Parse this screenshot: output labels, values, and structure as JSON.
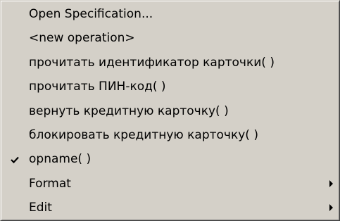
{
  "menu": {
    "items": [
      {
        "label": "Open Specification..."
      },
      {
        "label": "<new operation>"
      },
      {
        "label": "прочитать идентификатор карточки( )"
      },
      {
        "label": "прочитать ПИН-код( )"
      },
      {
        "label": "вернуть кредитную карточку( )"
      },
      {
        "label": "блокировать кредитную карточку( )"
      },
      {
        "label": "opname( )",
        "checked": true,
        "icon": "check-icon"
      },
      {
        "label": "Format",
        "submenu": true,
        "icon": "submenu-arrow-icon"
      },
      {
        "label": "Edit",
        "submenu": true,
        "icon": "submenu-arrow-icon"
      }
    ]
  },
  "colors": {
    "menu_background": "#d4d0c8",
    "text": "#000000"
  }
}
